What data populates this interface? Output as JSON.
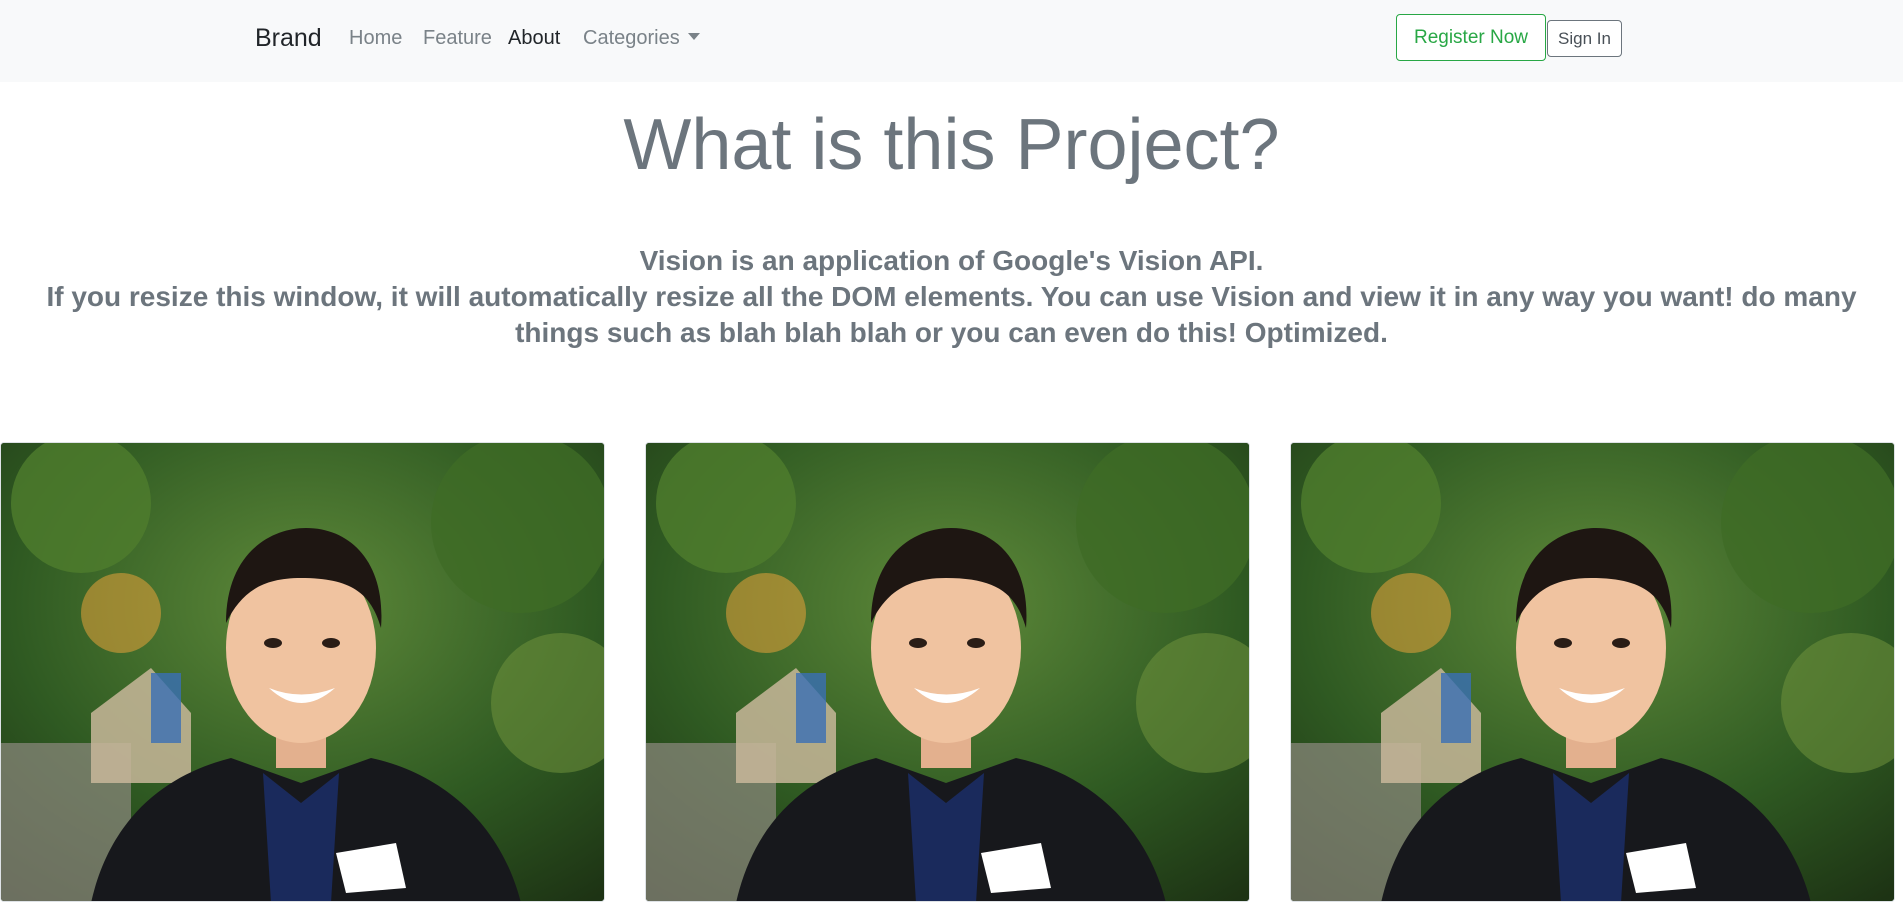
{
  "navbar": {
    "brand": "Brand",
    "links": [
      "Home",
      "Feature",
      "About",
      "Categories"
    ],
    "register_label": "Register Now",
    "signin_label": "Sign In"
  },
  "hero": {
    "title": "What is this Project?",
    "line1": "Vision is an application of Google's Vision API.",
    "line2": "If you resize this window, it will automatically resize all the DOM elements. You can use Vision and view it in any way you want! do many",
    "line3": "things such as blah blah blah or you can even do this! Optimized."
  },
  "colors": {
    "navbar_bg": "#f8f9fa",
    "register_accent": "#28a745",
    "muted_text": "#6c757d"
  },
  "cards": [
    {
      "image": "portrait-photo"
    },
    {
      "image": "portrait-photo"
    },
    {
      "image": "portrait-photo"
    }
  ]
}
